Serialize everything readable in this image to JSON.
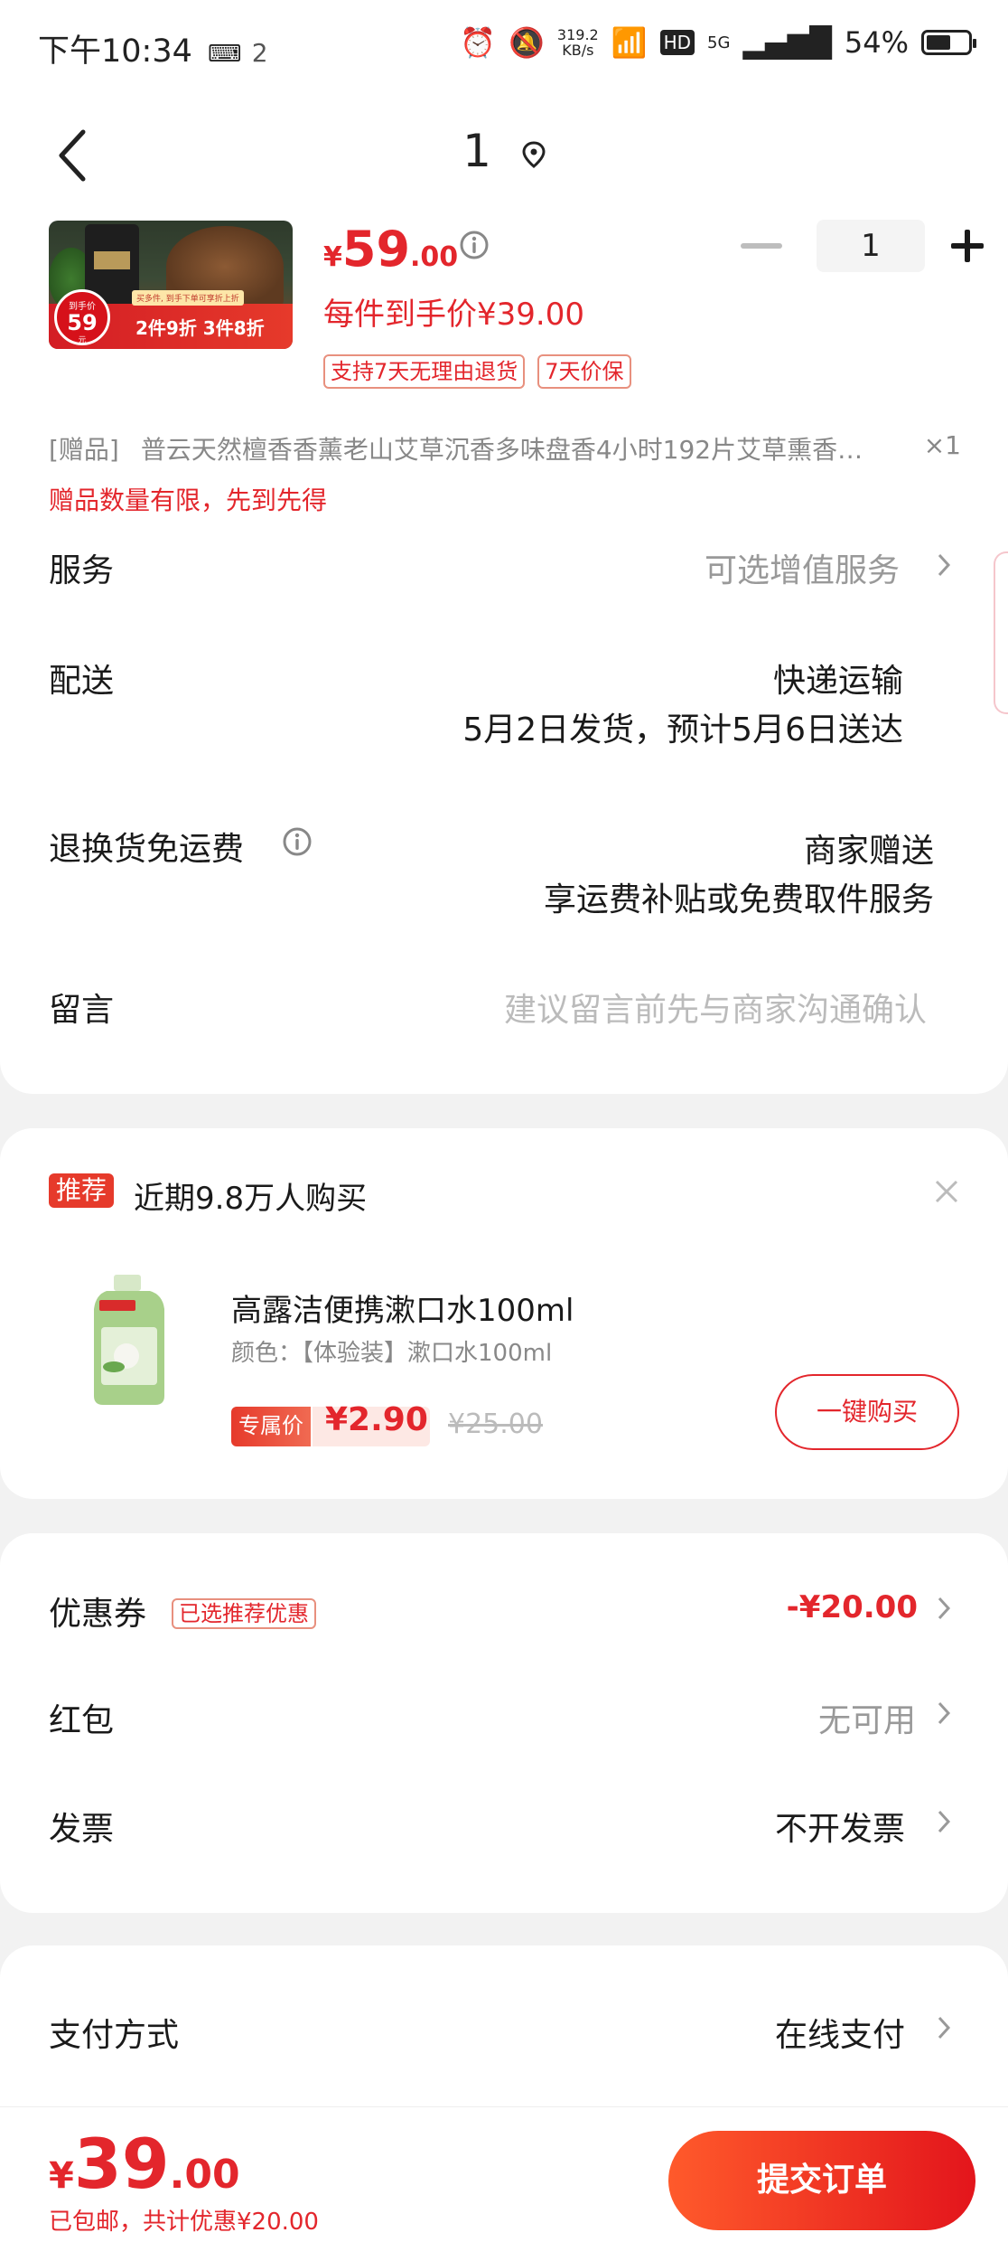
{
  "status_bar": {
    "time": "下午10:34",
    "notif_count": "2",
    "net_speed_value": "319.2",
    "net_speed_unit": "KB/s",
    "hd": "HD",
    "network": "5G",
    "battery": "54%"
  },
  "header": {
    "title": "1"
  },
  "product": {
    "currency": "¥",
    "price_int": "59",
    "price_dec": ".00",
    "quantity": "1",
    "unit_price_text": "每件到手价¥39.00",
    "tags": [
      "支持7天无理由退货",
      "7天价保"
    ],
    "image_label": "到手价",
    "image_price": "59",
    "image_price_unit": "元",
    "image_promo": "2件9折 3件8折",
    "image_tip": "买多件, 到手下单可享折上折"
  },
  "gift": {
    "tag": "[赠品]",
    "name": "普云天然檀香香薰老山艾草沉香多味盘香4小时192片艾草熏香…",
    "qty": "×1",
    "note": "赠品数量有限，先到先得"
  },
  "service": {
    "label": "服务",
    "value": "可选增值服务"
  },
  "delivery": {
    "label": "配送",
    "method": "快递运输",
    "eta": "5月2日发货，预计5月6日送达"
  },
  "return_fee": {
    "label": "退换货免运费",
    "value": "商家赠送",
    "detail": "享运费补贴或免费取件服务"
  },
  "message": {
    "label": "留言",
    "placeholder": "建议留言前先与商家沟通确认"
  },
  "recommend": {
    "badge": "推荐",
    "title": "近期9.8万人购买",
    "product_name": "高露洁便携漱口水100ml",
    "spec": "颜色：【体验装】漱口水100ml",
    "exclusive_label": "专属价",
    "price": "¥2.90",
    "old_price": "¥25.00",
    "buy_label": "一键购买"
  },
  "coupon": {
    "label": "优惠券",
    "tag": "已选推荐优惠",
    "value": "-¥20.00"
  },
  "red_packet": {
    "label": "红包",
    "value": "无可用"
  },
  "invoice": {
    "label": "发票",
    "value": "不开发票"
  },
  "payment": {
    "label": "支付方式",
    "value": "在线支付"
  },
  "bottom": {
    "currency": "¥",
    "total_int": "39",
    "total_dec": ".00",
    "note": "已包邮，共计优惠¥20.00",
    "submit_label": "提交订单"
  },
  "colors": {
    "accent": "#e3262c",
    "background": "#f2f2f2"
  }
}
